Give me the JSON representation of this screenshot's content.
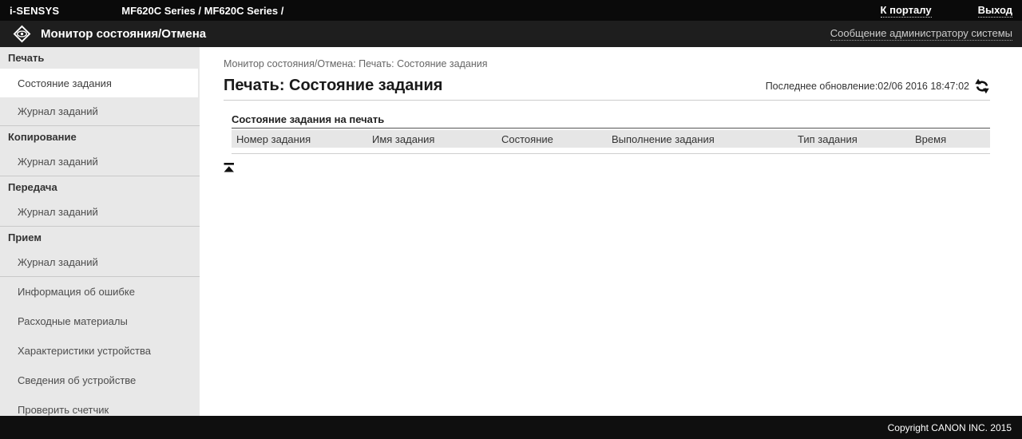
{
  "topbar": {
    "brand": "i-SENSYS",
    "device": "MF620C Series / MF620C Series /",
    "portal_link": "К порталу",
    "logout_link": "Выход"
  },
  "appbar": {
    "title": "Монитор состояния/Отмена",
    "icon": "status-monitor-diamond-eye-icon",
    "admin_message_link": "Сообщение администратору системы"
  },
  "sidebar": {
    "groups": [
      {
        "header": "Печать",
        "items": [
          {
            "label": "Состояние задания",
            "selected": true
          },
          {
            "label": "Журнал заданий",
            "selected": false
          }
        ]
      },
      {
        "header": "Копирование",
        "items": [
          {
            "label": "Журнал заданий",
            "selected": false
          }
        ]
      },
      {
        "header": "Передача",
        "items": [
          {
            "label": "Журнал заданий",
            "selected": false
          }
        ]
      },
      {
        "header": "Прием",
        "items": [
          {
            "label": "Журнал заданий",
            "selected": false
          }
        ]
      }
    ],
    "standalone_items": [
      "Информация об ошибке",
      "Расходные материалы",
      "Характеристики устройства",
      "Сведения об устройстве",
      "Проверить счетчик"
    ]
  },
  "main": {
    "breadcrumb": "Монитор состояния/Отмена: Печать: Состояние задания",
    "page_title": "Печать: Состояние задания",
    "last_update_label": "Последнее обновление:",
    "last_update_value": "02/06 2016 18:47:02",
    "refresh_icon": "refresh-icon",
    "section_title": "Состояние задания на печать",
    "table": {
      "columns": [
        "Номер задания",
        "Имя задания",
        "Состояние",
        "Выполнение задания",
        "Тип задания",
        "Время"
      ],
      "rows": []
    },
    "back_to_top_icon": "back-to-top-icon"
  },
  "footer": {
    "copyright": "Copyright CANON INC. 2015"
  },
  "colors": {
    "topbar_bg": "#0a0a0a",
    "appbar_bg": "#1e1e1e",
    "sidebar_bg": "#e8e8e8",
    "selected_item_bg": "#ffffff",
    "table_header_bg": "#e6e6e6",
    "footer_bg": "#0f0f0f"
  }
}
